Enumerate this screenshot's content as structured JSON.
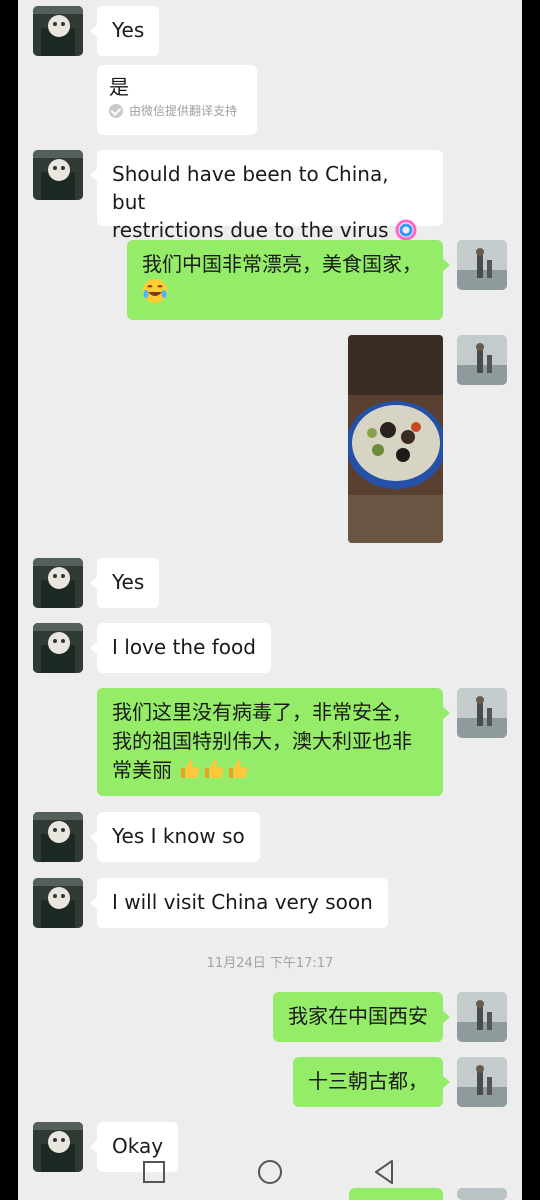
{
  "messages": [
    {
      "text": "Yes"
    },
    {
      "text": "是",
      "note": "由微信提供翻译支持"
    },
    {
      "text_line1": "Should have been to China, but",
      "text_line2": "restrictions due to the virus"
    },
    {
      "text": "我们中国非常漂亮，美食国家，"
    },
    {
      "text": "Yes"
    },
    {
      "text": "I love the food"
    },
    {
      "line1": "我们这里没有病毒了，非常安全，",
      "line2": "我的祖国特别伟大，澳大利亚也非",
      "line3": "常美丽"
    },
    {
      "text": "Yes I know so"
    },
    {
      "text": "I will visit China very soon"
    },
    {
      "text": "我家在中国西安"
    },
    {
      "text": "十三朝古都，"
    },
    {
      "text": "Okay"
    }
  ],
  "timestamp": "11月24日 下午17:17",
  "icons": {
    "laugh_emoji": "face-with-tears-of-joy",
    "thumbs_up": "thumbs-up-emoji",
    "rainbow": "rainbow-emoji",
    "nav": [
      "square-recents-icon",
      "circle-home-icon",
      "triangle-back-icon"
    ]
  },
  "colors": {
    "my_bubble": "#95ec69",
    "their_bubble": "#ffffff",
    "background": "#ededed"
  }
}
